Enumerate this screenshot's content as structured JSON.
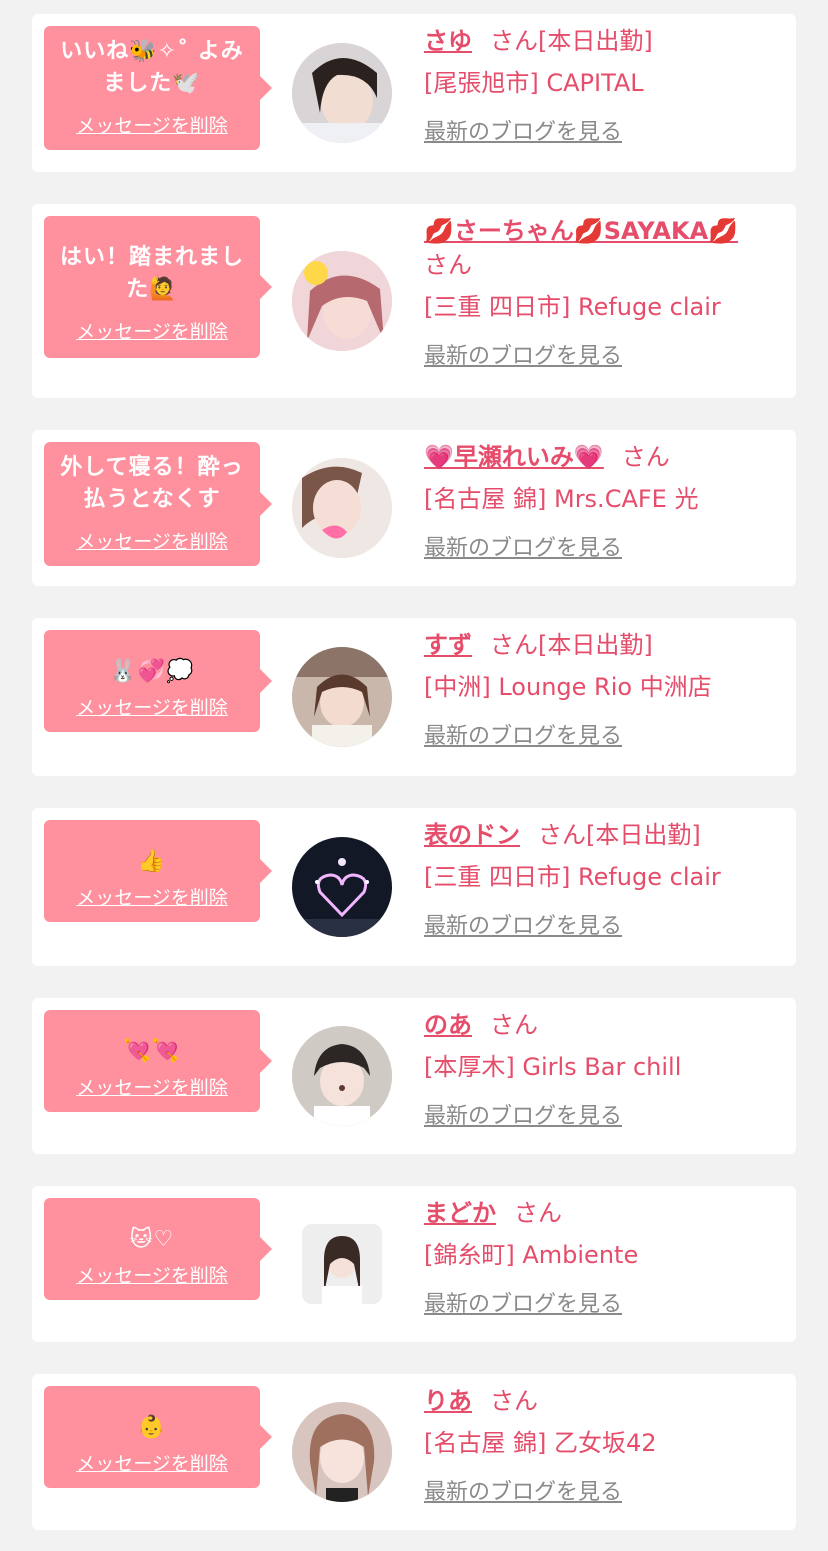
{
  "delete_label": "メッセージを削除",
  "blog_label": "最新のブログを見る",
  "honorific": "さん",
  "accent_color": "#e54d6b",
  "bubble_color": "#ff919f",
  "cards": [
    {
      "message": "いいね🐝✧˚ よみました🕊️",
      "name": "さゆ",
      "status": "[本日出勤]",
      "shop": "[尾張旭市] CAPITAL"
    },
    {
      "message": "はい！踏まれました🙋",
      "name": "💋さーちゃん💋SAYAKA💋",
      "status": "",
      "shop": "[三重 四日市] Refuge clair"
    },
    {
      "message": "外して寝る！酔っ払うとなくす",
      "name": "💗早瀬れいみ💗",
      "status": "",
      "shop": "[名古屋 錦] Mrs.CAFE 光"
    },
    {
      "message": "🐰💞💭",
      "name": "すず",
      "status": "[本日出勤]",
      "shop": "[中洲] Lounge Rio 中洲店"
    },
    {
      "message": "👍",
      "name": "表のドン",
      "status": "[本日出勤]",
      "shop": "[三重 四日市] Refuge clair"
    },
    {
      "message": "💘💘",
      "name": "のあ",
      "status": "",
      "shop": "[本厚木] Girls Bar chill"
    },
    {
      "message": "🐱♡",
      "name": "まどか",
      "status": "",
      "shop": "[錦糸町] Ambiente"
    },
    {
      "message": "👶",
      "name": "りあ",
      "status": "",
      "shop": "[名古屋 錦] 乙女坂42"
    }
  ]
}
